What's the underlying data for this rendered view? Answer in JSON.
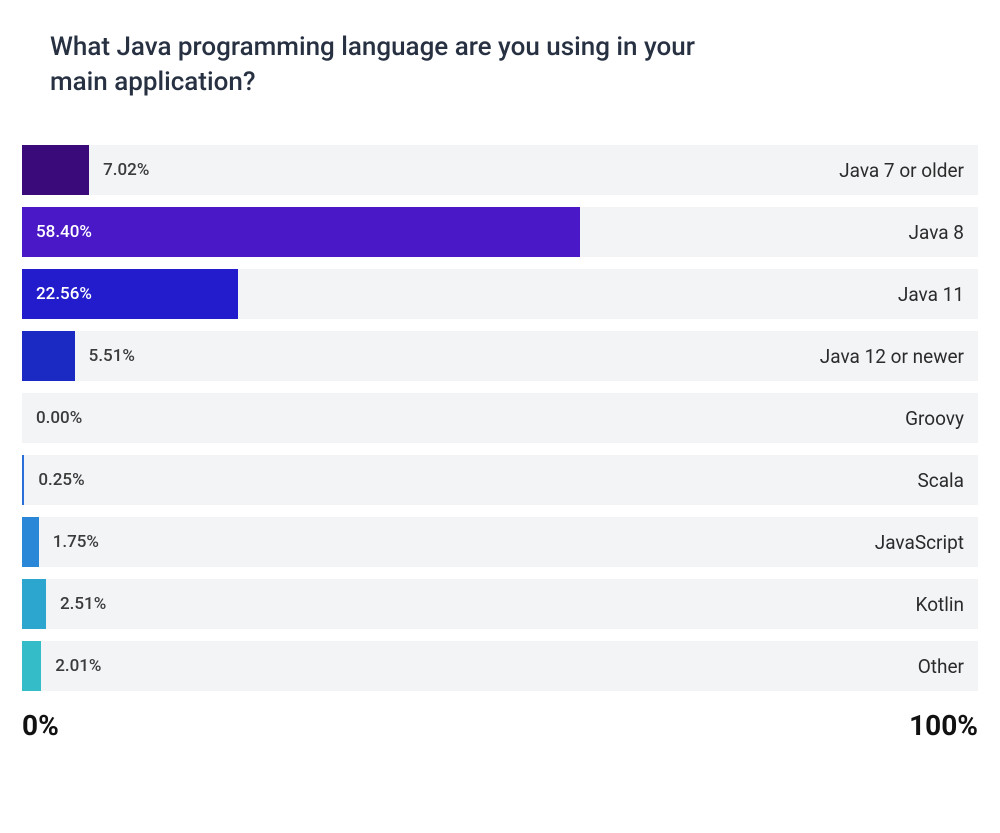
{
  "chart_data": {
    "type": "bar",
    "title": "What Java programming language are you using in your main application?",
    "xlabel": "",
    "ylabel": "",
    "xlim": [
      0,
      100
    ],
    "categories": [
      "Java 7 or older",
      "Java 8",
      "Java 11",
      "Java 12 or newer",
      "Groovy",
      "Scala",
      "JavaScript",
      "Kotlin",
      "Other"
    ],
    "values": [
      7.02,
      58.4,
      22.56,
      5.51,
      0.0,
      0.25,
      1.75,
      2.51,
      2.01
    ],
    "axis_min_label": "0%",
    "axis_max_label": "100%",
    "series": [
      {
        "category": "Java 7 or older",
        "value": 7.02,
        "pct_label": "7.02%",
        "color": "#3a0a7a",
        "label_inside": false
      },
      {
        "category": "Java 8",
        "value": 58.4,
        "pct_label": "58.40%",
        "color": "#4a18c7",
        "label_inside": true
      },
      {
        "category": "Java 11",
        "value": 22.56,
        "pct_label": "22.56%",
        "color": "#221ccc",
        "label_inside": true
      },
      {
        "category": "Java 12 or newer",
        "value": 5.51,
        "pct_label": "5.51%",
        "color": "#1a2ac2",
        "label_inside": false
      },
      {
        "category": "Groovy",
        "value": 0.0,
        "pct_label": "0.00%",
        "color": "#1f4fd1",
        "label_inside": false
      },
      {
        "category": "Scala",
        "value": 0.25,
        "pct_label": "0.25%",
        "color": "#2a6ed9",
        "label_inside": false
      },
      {
        "category": "JavaScript",
        "value": 1.75,
        "pct_label": "1.75%",
        "color": "#2a86d6",
        "label_inside": false
      },
      {
        "category": "Kotlin",
        "value": 2.51,
        "pct_label": "2.51%",
        "color": "#2ca5cf",
        "label_inside": false
      },
      {
        "category": "Other",
        "value": 2.01,
        "pct_label": "2.01%",
        "color": "#34bcc9",
        "label_inside": false
      }
    ]
  }
}
